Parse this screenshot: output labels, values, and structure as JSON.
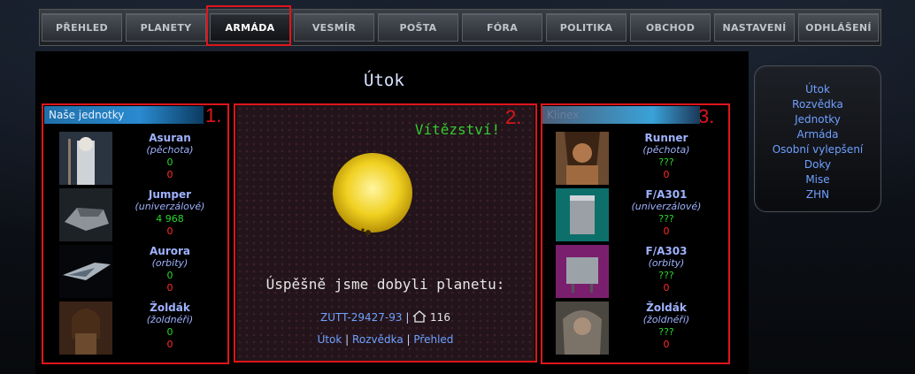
{
  "nav": {
    "items": [
      "PŘEHLED",
      "PLANETY",
      "ARMÁDA",
      "VESMÍR",
      "POŠTA",
      "FÓRA",
      "POLITIKA",
      "OBCHOD",
      "NASTAVENÍ",
      "ODHLÁŠENÍ"
    ],
    "active": "ARMÁDA"
  },
  "page": {
    "title": "Útok"
  },
  "panels": {
    "left_num": "1.",
    "middle_num": "2.",
    "right_num": "3."
  },
  "our_units": {
    "header": "Naše jednotky",
    "units": [
      {
        "name": "Asuran",
        "type": "(pěchota)",
        "v1": "0",
        "v2": "0"
      },
      {
        "name": "Jumper",
        "type": "(univerzálové)",
        "v1": "4 968",
        "v2": "0"
      },
      {
        "name": "Aurora",
        "type": "(orbity)",
        "v1": "0",
        "v2": "0"
      },
      {
        "name": "Žoldák",
        "type": "(žoldnéři)",
        "v1": "0",
        "v2": "0"
      }
    ]
  },
  "enemy_units": {
    "header": "Klinex",
    "units": [
      {
        "name": "Runner",
        "type": "(pěchota)",
        "v1": "???",
        "v2": "0"
      },
      {
        "name": "F/A301",
        "type": "(univerzálové)",
        "v1": "???",
        "v2": "0"
      },
      {
        "name": "F/A303",
        "type": "(orbity)",
        "v1": "???",
        "v2": "0"
      },
      {
        "name": "Žoldák",
        "type": "(žoldnéři)",
        "v1": "???",
        "v2": "0"
      }
    ]
  },
  "result": {
    "title": "Vítězství!",
    "message": "Úspěšně jsme dobyli planetu:",
    "planet": "ZUTT-29427-93",
    "separator": "|",
    "planet_count": "116",
    "links": [
      "Útok",
      "Rozvědka",
      "Přehled"
    ]
  },
  "menu": {
    "items": [
      "Útok",
      "Rozvědka",
      "Jednotky",
      "Armáda",
      "Osobní vylepšení",
      "Doky",
      "Mise",
      "ZHN"
    ]
  },
  "colors": {
    "accent_red": "#e0151b",
    "victory_green": "#33cc33",
    "link_blue": "#6fa0ff"
  }
}
